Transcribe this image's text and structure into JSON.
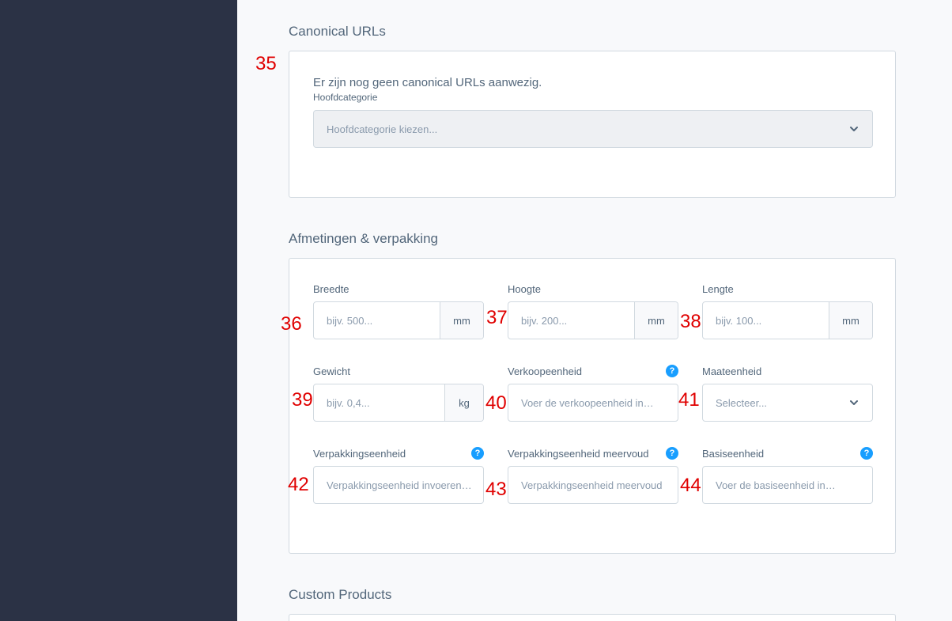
{
  "canonical": {
    "section_title": "Canonical URLs",
    "marker": "35",
    "notice": "Er zijn nog geen canonical URLs aanwezig.",
    "main_category_label": "Hoofdcategorie",
    "main_category_placeholder": "Hoofdcategorie kiezen..."
  },
  "dimensions": {
    "section_title": "Afmetingen & verpakking",
    "width": {
      "label": "Breedte",
      "placeholder": "bijv. 500...",
      "unit": "mm",
      "marker": "36"
    },
    "height": {
      "label": "Hoogte",
      "placeholder": "bijv. 200...",
      "unit": "mm",
      "marker": "37"
    },
    "length": {
      "label": "Lengte",
      "placeholder": "bijv. 100...",
      "unit": "mm",
      "marker": "38"
    },
    "weight": {
      "label": "Gewicht",
      "placeholder": "bijv. 0,4...",
      "unit": "kg",
      "marker": "39"
    },
    "sales_unit": {
      "label": "Verkoopeenheid",
      "placeholder": "Voer de verkoopeenheid in…",
      "marker": "40",
      "help": "?"
    },
    "measure_unit": {
      "label": "Maateenheid",
      "placeholder": "Selecteer...",
      "marker": "41"
    },
    "packaging_unit": {
      "label": "Verpakkingseenheid",
      "placeholder": "Verpakkingseenheid invoeren…",
      "marker": "42",
      "help": "?"
    },
    "packaging_unit_plural": {
      "label": "Verpakkingseenheid meervoud",
      "placeholder": "Verpakkingseenheid meervoud",
      "marker": "43",
      "help": "?"
    },
    "base_unit": {
      "label": "Basiseenheid",
      "placeholder": "Voer de basiseenheid in…",
      "marker": "44",
      "help": "?"
    }
  },
  "custom_products": {
    "section_title": "Custom Products"
  },
  "colors": {
    "sidebar": "#2b3245",
    "help_icon": "#189eff",
    "marker": "#e00000"
  }
}
